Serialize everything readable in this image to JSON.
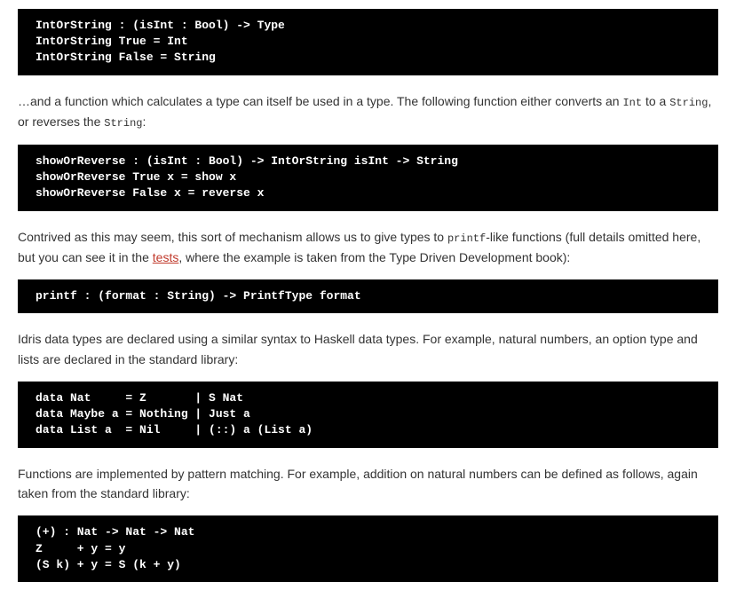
{
  "code1": "IntOrString : (isInt : Bool) -> Type\nIntOrString True = Int\nIntOrString False = String",
  "para1_a": "…and a function which calculates a type can itself be used in a type. The following function either converts an ",
  "para1_code1": "Int",
  "para1_b": " to a ",
  "para1_code2": "String",
  "para1_c": ", or reverses the ",
  "para1_code3": "String",
  "para1_d": ":",
  "code2": "showOrReverse : (isInt : Bool) -> IntOrString isInt -> String\nshowOrReverse True x = show x\nshowOrReverse False x = reverse x",
  "para2_a": "Contrived as this may seem, this sort of mechanism allows us to give types to ",
  "para2_code1": "printf",
  "para2_b": "-like functions (full details omitted here, but you can see it in the ",
  "para2_link": "tests",
  "para2_c": ", where the example is taken from the Type Driven Development book):",
  "code3": "printf : (format : String) -> PrintfType format",
  "para3": "Idris data types are declared using a similar syntax to Haskell data types. For example, natural numbers, an option type and lists are declared in the standard library:",
  "code4": "data Nat     = Z       | S Nat\ndata Maybe a = Nothing | Just a\ndata List a  = Nil     | (::) a (List a)",
  "para4": "Functions are implemented by pattern matching. For example, addition on natural numbers can be defined as follows, again taken from the standard library:",
  "code5": "(+) : Nat -> Nat -> Nat\nZ     + y = y\n(S k) + y = S (k + y)"
}
